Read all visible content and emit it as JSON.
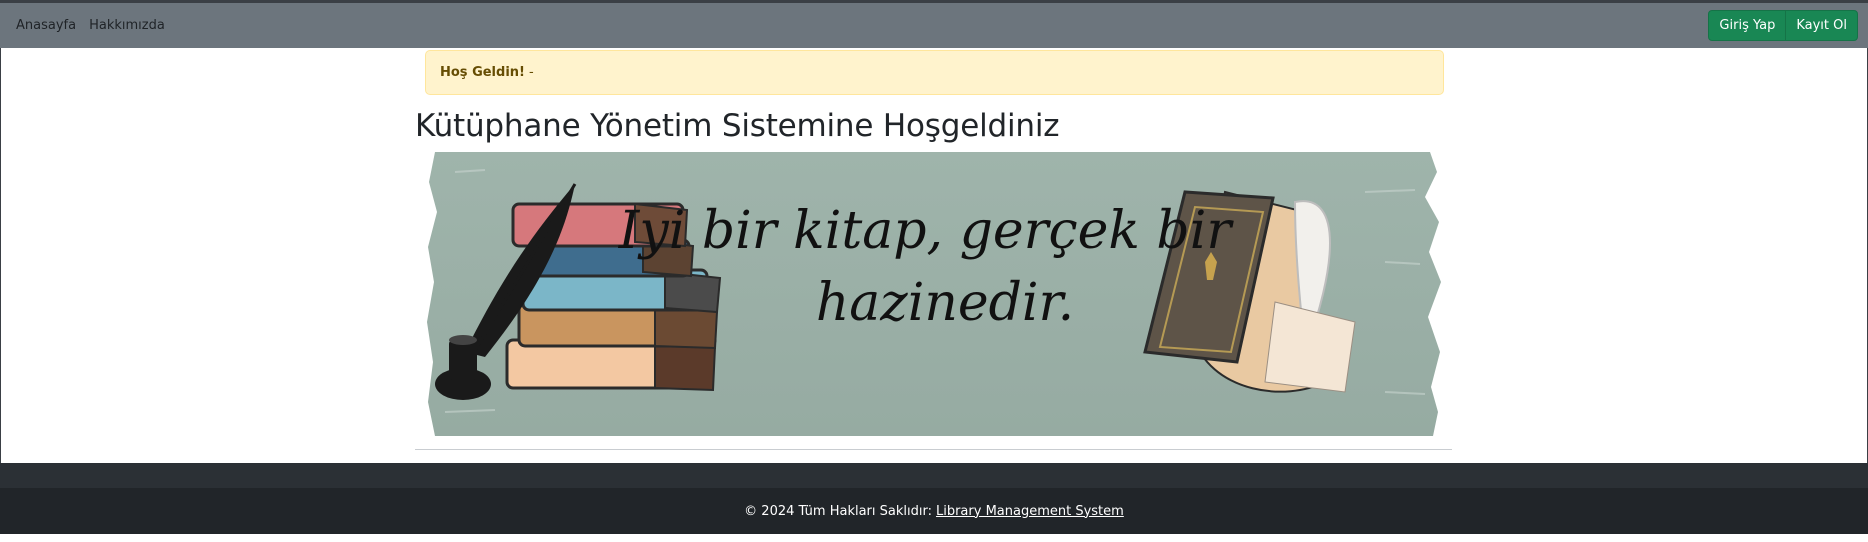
{
  "navbar": {
    "links": [
      "Anasayfa",
      "Hakkımızda"
    ],
    "login_label": "Giriş Yap",
    "register_label": "Kayıt Ol"
  },
  "alert": {
    "bold": "Hoş Geldin!",
    "text": "-"
  },
  "main": {
    "title": "Kütüphane Yönetim Sistemine Hoşgeldiniz",
    "banner_line1": "Iyi bir kitap, gerçek bir",
    "banner_line2": "hazinedir."
  },
  "footer": {
    "copyright": "© 2024 Tüm Hakları Saklıdır:",
    "link": "Library Management System"
  },
  "colors": {
    "navbar_bg": "#6c757d",
    "button_green": "#198754",
    "alert_bg": "#fff3cd",
    "banner_bg": "#9db2a9",
    "footer_bg": "#212529"
  }
}
